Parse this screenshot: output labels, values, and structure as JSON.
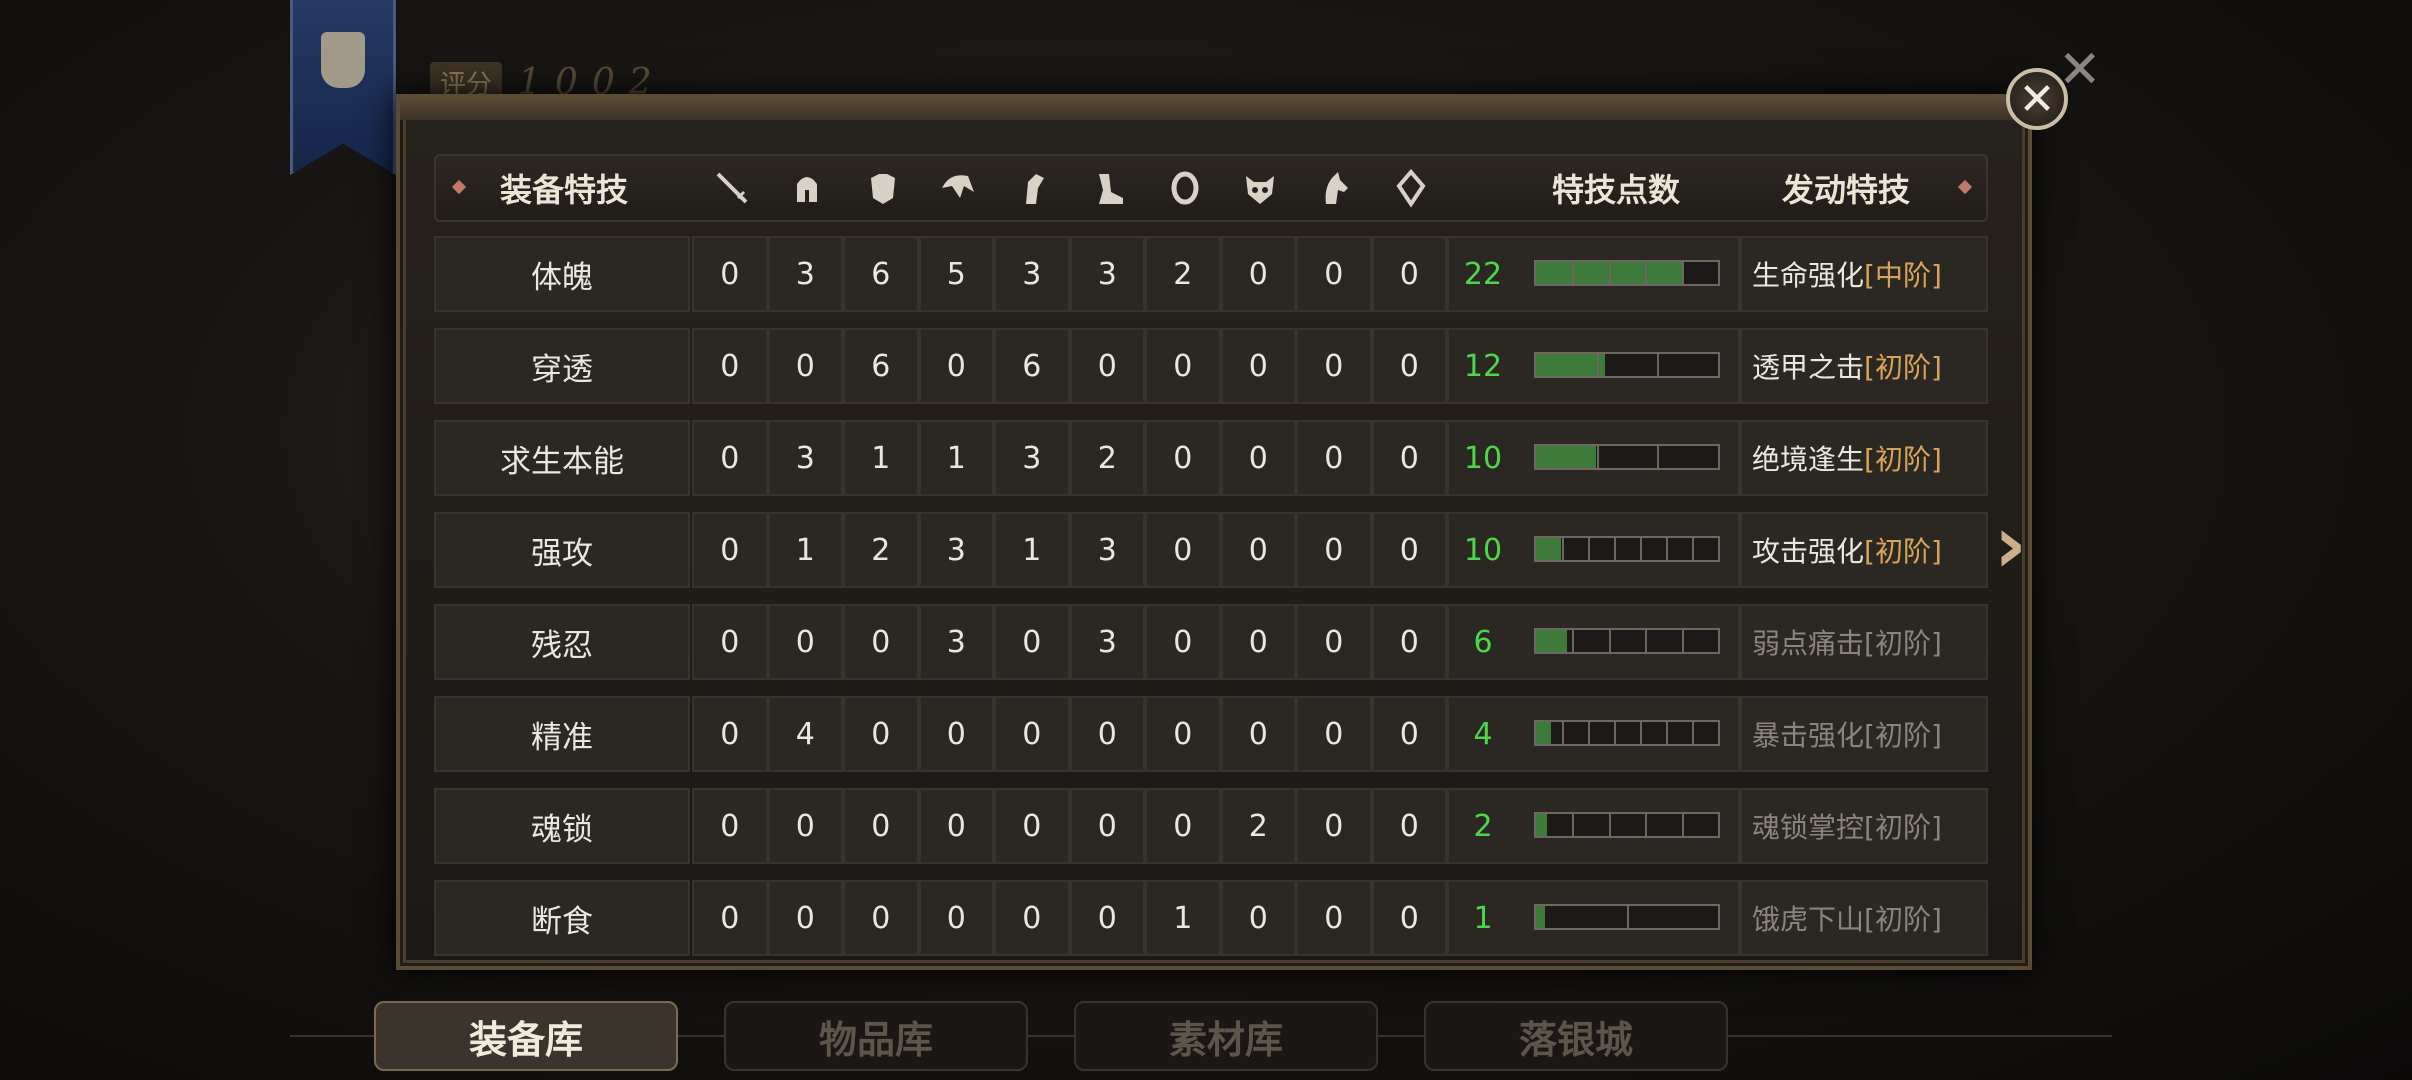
{
  "score": {
    "label": "评分",
    "value": "1002"
  },
  "header": {
    "title": "装备特技",
    "points_label": "特技点数",
    "skill_label": "发动特技",
    "slot_icons": [
      "sword-icon",
      "helmet-icon",
      "armor-icon",
      "shoulder-icon",
      "glove-icon",
      "boots-icon",
      "ring-icon",
      "mask-icon",
      "horse-icon",
      "amulet-icon"
    ]
  },
  "rows": [
    {
      "name": "体魄",
      "slots": [
        "0",
        "3",
        "6",
        "5",
        "3",
        "3",
        "2",
        "0",
        "0",
        "0"
      ],
      "points": "22",
      "fill": 0.8,
      "segments": 5,
      "skill": "生命强化",
      "tier": "[中阶]",
      "active": true
    },
    {
      "name": "穿透",
      "slots": [
        "0",
        "0",
        "6",
        "0",
        "6",
        "0",
        "0",
        "0",
        "0",
        "0"
      ],
      "points": "12",
      "fill": 0.38,
      "segments": 3,
      "skill": "透甲之击",
      "tier": "[初阶]",
      "active": true
    },
    {
      "name": "求生本能",
      "slots": [
        "0",
        "3",
        "1",
        "1",
        "3",
        "2",
        "0",
        "0",
        "0",
        "0"
      ],
      "points": "10",
      "fill": 0.33,
      "segments": 3,
      "skill": "绝境逢生",
      "tier": "[初阶]",
      "active": true
    },
    {
      "name": "强攻",
      "slots": [
        "0",
        "1",
        "2",
        "3",
        "1",
        "3",
        "0",
        "0",
        "0",
        "0"
      ],
      "points": "10",
      "fill": 0.14,
      "segments": 7,
      "skill": "攻击强化",
      "tier": "[初阶]",
      "active": true
    },
    {
      "name": "残忍",
      "slots": [
        "0",
        "0",
        "0",
        "3",
        "0",
        "3",
        "0",
        "0",
        "0",
        "0"
      ],
      "points": "6",
      "fill": 0.17,
      "segments": 5,
      "skill": "弱点痛击",
      "tier": "[初阶]",
      "active": false
    },
    {
      "name": "精准",
      "slots": [
        "0",
        "4",
        "0",
        "0",
        "0",
        "0",
        "0",
        "0",
        "0",
        "0"
      ],
      "points": "4",
      "fill": 0.08,
      "segments": 7,
      "skill": "暴击强化",
      "tier": "[初阶]",
      "active": false
    },
    {
      "name": "魂锁",
      "slots": [
        "0",
        "0",
        "0",
        "0",
        "0",
        "0",
        "0",
        "2",
        "0",
        "0"
      ],
      "points": "2",
      "fill": 0.06,
      "segments": 5,
      "skill": "魂锁掌控",
      "tier": "[初阶]",
      "active": false
    },
    {
      "name": "断食",
      "slots": [
        "0",
        "0",
        "0",
        "0",
        "0",
        "0",
        "1",
        "0",
        "0",
        "0"
      ],
      "points": "1",
      "fill": 0.05,
      "segments": 2,
      "skill": "饿虎下山",
      "tier": "[初阶]",
      "active": false
    }
  ],
  "tabs": [
    {
      "label": "装备库",
      "active": true
    },
    {
      "label": "物品库",
      "active": false
    },
    {
      "label": "素材库",
      "active": false
    },
    {
      "label": "落银城",
      "active": false
    }
  ]
}
